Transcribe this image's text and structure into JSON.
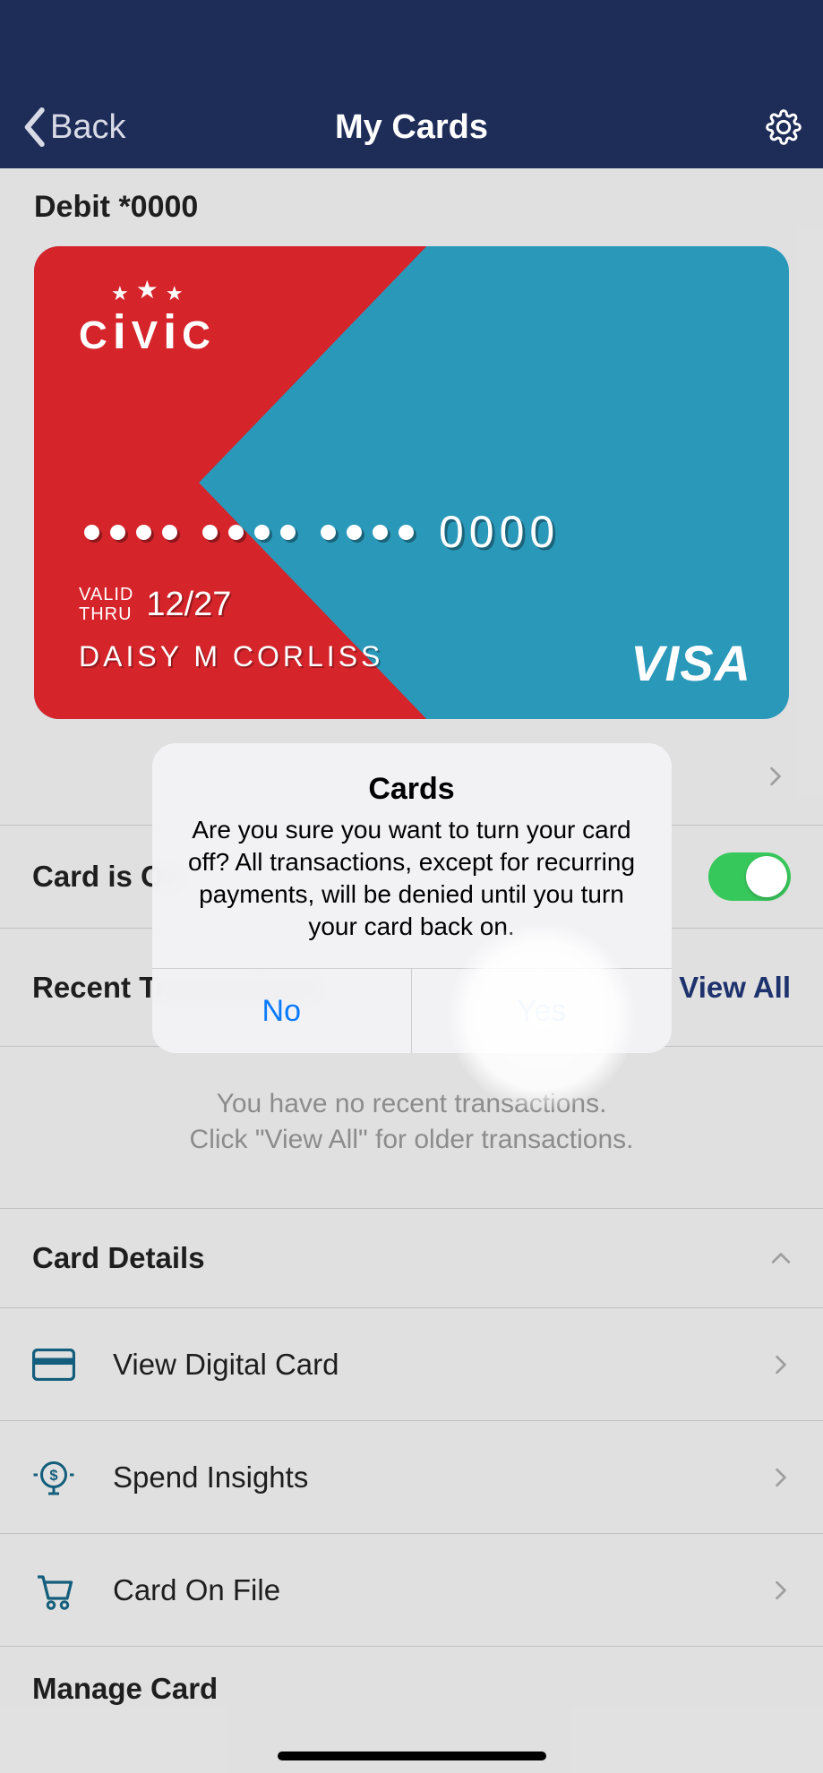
{
  "header": {
    "back_label": "Back",
    "title": "My Cards"
  },
  "card": {
    "label": "Debit *0000",
    "brand": "CIVIC",
    "last4": "0000",
    "valid_label": "VALID\nTHRU",
    "valid_thru": "12/27",
    "holder": "DAISY M CORLISS",
    "network": "VISA"
  },
  "toggle": {
    "label": "Card is On",
    "value": true
  },
  "recent": {
    "title": "Recent Transactions",
    "view_all": "View All",
    "empty_line1": "You have no recent transactions.",
    "empty_line2": "Click \"View All\" for older transactions."
  },
  "card_details": {
    "title": "Card Details",
    "items": [
      {
        "icon": "card",
        "label": "View Digital Card"
      },
      {
        "icon": "insights",
        "label": "Spend Insights"
      },
      {
        "icon": "cart",
        "label": "Card On File"
      }
    ]
  },
  "next_section": {
    "title": "Manage Card"
  },
  "alert": {
    "title": "Cards",
    "message": "Are you sure you want to turn your card off? All transactions, except for recurring payments, will be denied until you turn your card back on.",
    "no": "No",
    "yes": "Yes"
  }
}
